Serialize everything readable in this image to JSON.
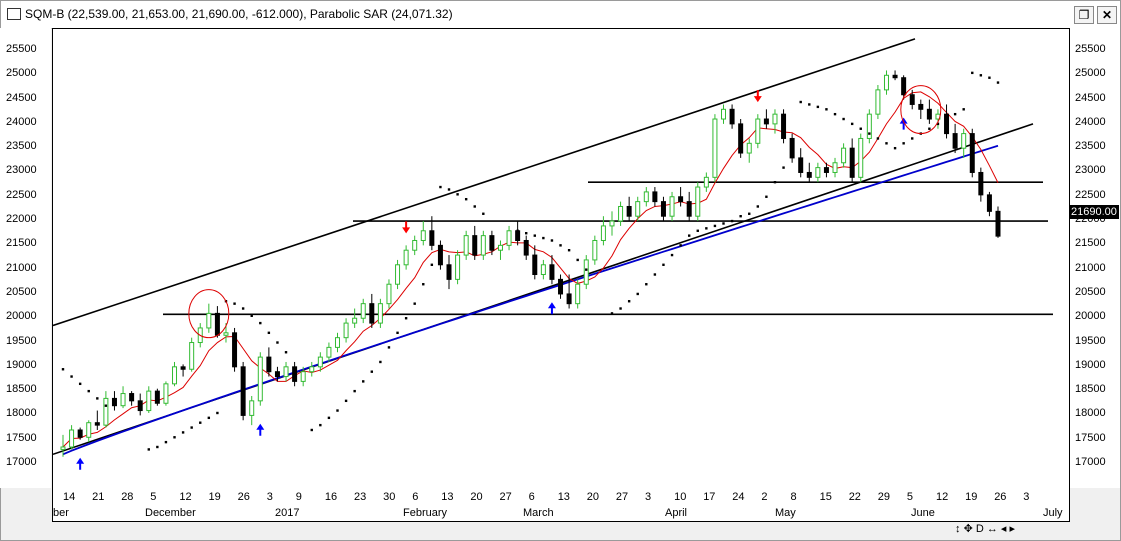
{
  "window": {
    "title": "SQM-B (22,539.00, 21,653.00, 21,690.00, -612.000), Parabolic SAR (24,071.32)",
    "restore_icon": "restore-window-icon",
    "close_icon": "close-window-icon"
  },
  "toolbar": {
    "nav_glyphs": [
      "↕",
      "✥",
      "D",
      "↔",
      "◂",
      "▸"
    ]
  },
  "chart_data": {
    "type": "candlestick",
    "symbol": "SQM-B",
    "ohlc": {
      "open": 22539.0,
      "high": 21653.0,
      "low": 21690.0,
      "change": -612.0
    },
    "indicator": {
      "name": "Parabolic SAR",
      "value": 24071.32
    },
    "last_price_label": "21690.00",
    "y_ticks": [
      17000,
      17500,
      18000,
      18500,
      19000,
      19500,
      20000,
      20500,
      21000,
      21500,
      22000,
      22500,
      23000,
      23500,
      24000,
      24500,
      25000,
      25500
    ],
    "x_day_ticks": [
      "14",
      "21",
      "28",
      "5",
      "12",
      "19",
      "26",
      "3",
      "9",
      "16",
      "23",
      "30",
      "6",
      "13",
      "20",
      "27",
      "6",
      "13",
      "20",
      "27",
      "3",
      "10",
      "17",
      "24",
      "2",
      "8",
      "15",
      "22",
      "29",
      "5",
      "12",
      "19",
      "26",
      "3"
    ],
    "x_month_labels": [
      "ber",
      "December",
      "2017",
      "February",
      "March",
      "April",
      "May",
      "June",
      "July"
    ],
    "horizontal_levels": [
      22000,
      22800,
      20080
    ],
    "colors": {
      "up": "#33bb33",
      "down": "#000000",
      "sar": "#000000",
      "ma_fast": "#dd0000",
      "ma_slow": "#0000cc",
      "arrow_up": "#0000ff",
      "arrow_down": "#ff0000",
      "circle": "#dd0000",
      "background": "#ffffff"
    },
    "candles": [
      [
        17300,
        17600,
        17150,
        17350
      ],
      [
        17350,
        17800,
        17300,
        17700
      ],
      [
        17700,
        17750,
        17500,
        17550
      ],
      [
        17550,
        17900,
        17450,
        17850
      ],
      [
        17850,
        18100,
        17700,
        17800
      ],
      [
        17800,
        18500,
        17750,
        18350
      ],
      [
        18350,
        18500,
        18100,
        18200
      ],
      [
        18200,
        18600,
        18150,
        18450
      ],
      [
        18450,
        18500,
        18200,
        18300
      ],
      [
        18300,
        18450,
        18000,
        18100
      ],
      [
        18100,
        18600,
        18050,
        18500
      ],
      [
        18500,
        18550,
        18200,
        18250
      ],
      [
        18250,
        18700,
        18200,
        18650
      ],
      [
        18650,
        19100,
        18600,
        19000
      ],
      [
        19000,
        19050,
        18800,
        18950
      ],
      [
        18950,
        19600,
        18900,
        19500
      ],
      [
        19500,
        19900,
        19400,
        19800
      ],
      [
        19800,
        20300,
        19700,
        20100
      ],
      [
        20100,
        20250,
        19600,
        19650
      ],
      [
        19650,
        19900,
        19500,
        19700
      ],
      [
        19700,
        19800,
        18900,
        19000
      ],
      [
        19000,
        19100,
        17900,
        18000
      ],
      [
        18000,
        18400,
        17800,
        18300
      ],
      [
        18300,
        19300,
        18200,
        19200
      ],
      [
        19200,
        19400,
        18800,
        18900
      ],
      [
        18900,
        19000,
        18700,
        18800
      ],
      [
        18800,
        19100,
        18700,
        19000
      ],
      [
        19000,
        19100,
        18600,
        18700
      ],
      [
        18700,
        19000,
        18600,
        18900
      ],
      [
        18900,
        19100,
        18800,
        19000
      ],
      [
        19000,
        19300,
        18900,
        19200
      ],
      [
        19200,
        19500,
        19100,
        19400
      ],
      [
        19400,
        19700,
        19300,
        19600
      ],
      [
        19600,
        20000,
        19500,
        19900
      ],
      [
        19900,
        20200,
        19800,
        20000
      ],
      [
        20000,
        20400,
        19900,
        20300
      ],
      [
        20300,
        20500,
        19800,
        19900
      ],
      [
        19900,
        20400,
        19800,
        20300
      ],
      [
        20300,
        20800,
        20200,
        20700
      ],
      [
        20700,
        21200,
        20600,
        21100
      ],
      [
        21100,
        21500,
        21000,
        21400
      ],
      [
        21400,
        21700,
        21300,
        21600
      ],
      [
        21600,
        22000,
        21500,
        21800
      ],
      [
        21800,
        22100,
        21400,
        21500
      ],
      [
        21500,
        21600,
        21000,
        21100
      ],
      [
        21100,
        21300,
        20600,
        20800
      ],
      [
        20800,
        21400,
        20700,
        21300
      ],
      [
        21300,
        21800,
        21200,
        21700
      ],
      [
        21700,
        21900,
        21200,
        21300
      ],
      [
        21300,
        21800,
        21200,
        21700
      ],
      [
        21700,
        21800,
        21300,
        21400
      ],
      [
        21400,
        21600,
        21200,
        21500
      ],
      [
        21500,
        21900,
        21400,
        21800
      ],
      [
        21800,
        22000,
        21500,
        21600
      ],
      [
        21600,
        21700,
        21200,
        21300
      ],
      [
        21300,
        21500,
        20800,
        20900
      ],
      [
        20900,
        21200,
        20800,
        21100
      ],
      [
        21100,
        21300,
        20700,
        20800
      ],
      [
        20800,
        20900,
        20400,
        20500
      ],
      [
        20500,
        20900,
        20200,
        20300
      ],
      [
        20300,
        20800,
        20200,
        20700
      ],
      [
        20700,
        21300,
        20600,
        21200
      ],
      [
        21200,
        21700,
        21100,
        21600
      ],
      [
        21600,
        22100,
        21500,
        21900
      ],
      [
        21900,
        22200,
        21700,
        22000
      ],
      [
        22000,
        22400,
        21900,
        22300
      ],
      [
        22300,
        22500,
        22000,
        22100
      ],
      [
        22100,
        22500,
        22000,
        22400
      ],
      [
        22400,
        22700,
        22300,
        22600
      ],
      [
        22600,
        22700,
        22300,
        22400
      ],
      [
        22400,
        22500,
        22000,
        22100
      ],
      [
        22100,
        22600,
        22000,
        22500
      ],
      [
        22500,
        22700,
        22300,
        22400
      ],
      [
        22400,
        22600,
        22000,
        22100
      ],
      [
        22100,
        22800,
        22000,
        22700
      ],
      [
        22700,
        23000,
        22600,
        22900
      ],
      [
        22900,
        24200,
        22800,
        24100
      ],
      [
        24100,
        24400,
        24000,
        24300
      ],
      [
        24300,
        24400,
        23900,
        24000
      ],
      [
        24000,
        24100,
        23300,
        23400
      ],
      [
        23400,
        23700,
        23200,
        23600
      ],
      [
        23600,
        24200,
        23500,
        24100
      ],
      [
        24100,
        24300,
        23900,
        24000
      ],
      [
        24000,
        24300,
        23800,
        24200
      ],
      [
        24200,
        24300,
        23600,
        23700
      ],
      [
        23700,
        23800,
        23200,
        23300
      ],
      [
        23300,
        23500,
        22900,
        23000
      ],
      [
        23000,
        23200,
        22800,
        22900
      ],
      [
        22900,
        23200,
        22800,
        23100
      ],
      [
        23100,
        23200,
        22900,
        23000
      ],
      [
        23000,
        23300,
        22900,
        23200
      ],
      [
        23200,
        23600,
        23100,
        23500
      ],
      [
        23500,
        23700,
        22800,
        22900
      ],
      [
        22900,
        23800,
        22800,
        23700
      ],
      [
        23700,
        24300,
        23600,
        24200
      ],
      [
        24200,
        24800,
        24100,
        24700
      ],
      [
        24700,
        25100,
        24600,
        25000
      ],
      [
        25000,
        25100,
        24900,
        24950
      ],
      [
        24950,
        25000,
        24500,
        24600
      ],
      [
        24600,
        24700,
        24300,
        24400
      ],
      [
        24400,
        24500,
        24100,
        24300
      ],
      [
        24300,
        24500,
        24000,
        24100
      ],
      [
        24100,
        24300,
        23900,
        24200
      ],
      [
        24200,
        24400,
        23700,
        23800
      ],
      [
        23800,
        24000,
        23400,
        23500
      ],
      [
        23500,
        23900,
        23300,
        23800
      ],
      [
        23800,
        23900,
        22900,
        23000
      ],
      [
        23000,
        23100,
        22400,
        22539
      ],
      [
        22539,
        22600,
        22100,
        22200
      ],
      [
        22200,
        22300,
        21653,
        21690
      ]
    ],
    "sar": [
      18950,
      18800,
      18650,
      18500,
      18350,
      18200,
      null,
      null,
      null,
      null,
      17300,
      17350,
      17450,
      17550,
      17650,
      17750,
      17850,
      17950,
      18050,
      20350,
      20300,
      20200,
      20050,
      19900,
      19700,
      19500,
      19300,
      null,
      null,
      17700,
      17800,
      17950,
      18100,
      18300,
      18500,
      18700,
      18900,
      19100,
      19400,
      19700,
      20000,
      20300,
      20700,
      21100,
      22700,
      22650,
      22550,
      22450,
      22300,
      22150,
      null,
      null,
      null,
      21800,
      21750,
      21700,
      21650,
      21600,
      21500,
      21400,
      21200,
      21000,
      null,
      null,
      20100,
      20200,
      20350,
      20500,
      20700,
      20900,
      21100,
      21300,
      21500,
      21700,
      21800,
      21850,
      21900,
      21950,
      22000,
      22100,
      22150,
      22300,
      22500,
      22800,
      23100,
      23400,
      24450,
      24400,
      24350,
      24300,
      24200,
      24100,
      24000,
      23900,
      23800,
      23700,
      23600,
      23500,
      23600,
      23700,
      23800,
      23900,
      24000,
      24100,
      24200,
      24300,
      25050,
      25000,
      24950,
      24850,
      24750,
      24600,
      24400,
      24200,
      24071.32
    ],
    "arrows_up_index": [
      2,
      23,
      57,
      98
    ],
    "arrows_down_index": [
      40,
      81
    ],
    "circles_index": [
      17,
      100
    ]
  }
}
